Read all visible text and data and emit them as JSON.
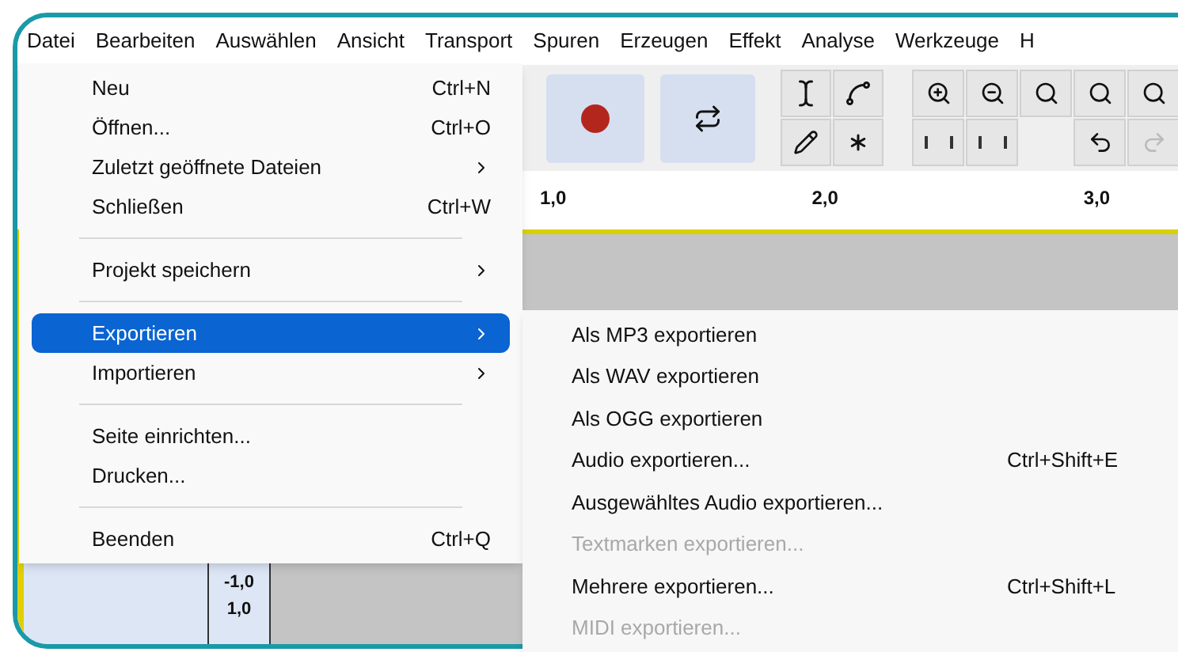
{
  "menubar": [
    {
      "label": "Datei"
    },
    {
      "label": "Bearbeiten"
    },
    {
      "label": "Auswählen"
    },
    {
      "label": "Ansicht"
    },
    {
      "label": "Transport"
    },
    {
      "label": "Spuren"
    },
    {
      "label": "Erzeugen"
    },
    {
      "label": "Effekt"
    },
    {
      "label": "Analyse"
    },
    {
      "label": "Werkzeuge"
    },
    {
      "label": "H"
    }
  ],
  "ruler": [
    "1,0",
    "2,0",
    "3,0"
  ],
  "track_scale": [
    "-1,0",
    "1,0"
  ],
  "file_menu": [
    {
      "kind": "item",
      "label": "Neu",
      "shortcut": "Ctrl+N",
      "submenu": false,
      "selected": false
    },
    {
      "kind": "item",
      "label": "Öffnen...",
      "shortcut": "Ctrl+O",
      "submenu": false,
      "selected": false
    },
    {
      "kind": "item",
      "label": "Zuletzt geöffnete Dateien",
      "submenu": true,
      "selected": false
    },
    {
      "kind": "item",
      "label": "Schließen",
      "shortcut": "Ctrl+W",
      "submenu": false,
      "selected": false
    },
    {
      "kind": "separator"
    },
    {
      "kind": "item",
      "label": "Projekt speichern",
      "submenu": true,
      "selected": false
    },
    {
      "kind": "separator"
    },
    {
      "kind": "item",
      "label": "Exportieren",
      "submenu": true,
      "selected": true
    },
    {
      "kind": "item",
      "label": "Importieren",
      "submenu": true,
      "selected": false
    },
    {
      "kind": "separator"
    },
    {
      "kind": "item",
      "label": "Seite einrichten...",
      "submenu": false,
      "selected": false
    },
    {
      "kind": "item",
      "label": "Drucken...",
      "submenu": false,
      "selected": false
    },
    {
      "kind": "separator"
    },
    {
      "kind": "item",
      "label": "Beenden",
      "shortcut": "Ctrl+Q",
      "submenu": false,
      "selected": false
    }
  ],
  "export_menu": [
    {
      "label": "Als MP3 exportieren",
      "disabled": false
    },
    {
      "label": "Als WAV exportieren",
      "disabled": false
    },
    {
      "label": "Als OGG exportieren",
      "disabled": false
    },
    {
      "label": "Audio exportieren...",
      "shortcut": "Ctrl+Shift+E",
      "disabled": false
    },
    {
      "label": "Ausgewähltes Audio exportieren...",
      "disabled": false
    },
    {
      "label": "Textmarken exportieren...",
      "disabled": true
    },
    {
      "label": "Mehrere exportieren...",
      "shortcut": "Ctrl+Shift+L",
      "disabled": false
    },
    {
      "label": "MIDI exportieren...",
      "disabled": true
    }
  ]
}
